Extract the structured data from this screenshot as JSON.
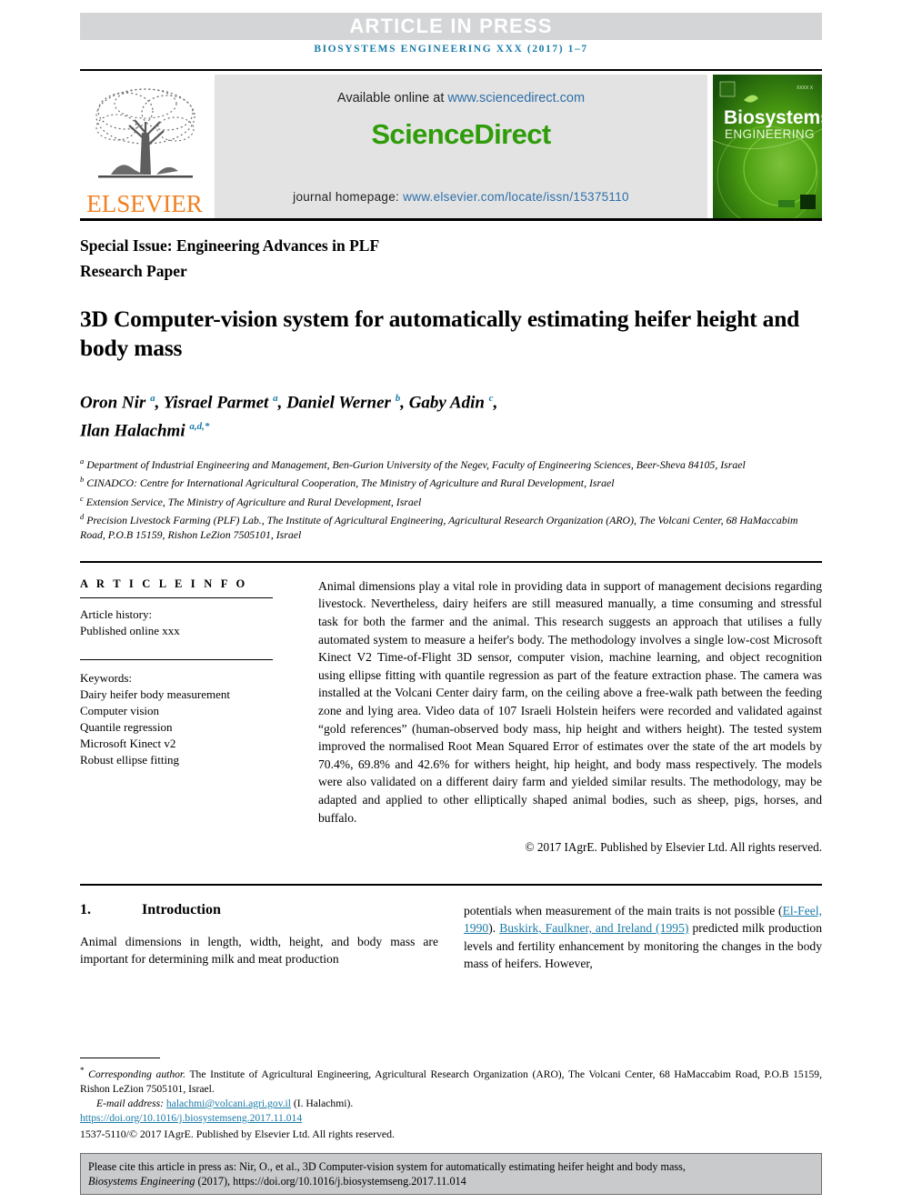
{
  "banner": {
    "text": "ARTICLE IN PRESS"
  },
  "journal_ref": "BIOSYSTEMS ENGINEERING XXX (2017) 1–7",
  "masthead": {
    "elsevier_wordmark": "ELSEVIER",
    "available_prefix": "Available online at ",
    "available_link": "www.sciencedirect.com",
    "sciencedirect_logo": "ScienceDirect",
    "homepage_prefix": "journal homepage: ",
    "homepage_link": "www.elsevier.com/locate/issn/15375110",
    "cover_title_line1": "Biosystems",
    "cover_title_line2": "ENGINEERING",
    "cover_issue": "XXXX X"
  },
  "header": {
    "special_issue": "Special Issue: Engineering Advances in PLF",
    "research_paper": "Research Paper"
  },
  "title": "3D Computer-vision system for automatically estimating heifer height and body mass",
  "authors_line1": "Oron Nir <sup>a</sup>, Yisrael Parmet <sup>a</sup>, Daniel Werner <sup>b</sup>, Gaby Adin <sup>c</sup>,",
  "authors_line2": "Ilan Halachmi <sup>a,d,*</sup>",
  "affiliations": [
    "<sup>a</sup> Department of Industrial Engineering and Management, Ben-Gurion University of the Negev, Faculty of Engineering Sciences, Beer-Sheva 84105, Israel",
    "<sup>b</sup> CINADCO: Centre for International Agricultural Cooperation, The Ministry of Agriculture and Rural Development, Israel",
    "<sup>c</sup> Extension Service, The Ministry of Agriculture and Rural Development, Israel",
    "<sup>d</sup> Precision Livestock Farming (PLF) Lab., The Institute of Agricultural Engineering, Agricultural Research Organization (ARO), The Volcani Center, 68 HaMaccabim Road, P.O.B 15159, Rishon LeZion 7505101, Israel"
  ],
  "article_info": {
    "heading": "A R T I C L E   I N F O",
    "history_label": "Article history:",
    "history_value": "Published online xxx",
    "keywords_label": "Keywords:",
    "keywords": [
      "Dairy heifer body measurement",
      "Computer vision",
      "Quantile regression",
      "Microsoft Kinect v2",
      "Robust ellipse fitting"
    ]
  },
  "abstract": "Animal dimensions play a vital role in providing data in support of management decisions regarding livestock. Nevertheless, dairy heifers are still measured manually, a time consuming and stressful task for both the farmer and the animal. This research suggests an approach that utilises a fully automated system to measure a heifer's body. The methodology involves a single low-cost Microsoft Kinect V2 Time-of-Flight 3D sensor, computer vision, machine learning, and object recognition using ellipse fitting with quantile regression as part of the feature extraction phase. The camera was installed at the Volcani Center dairy farm, on the ceiling above a free-walk path between the feeding zone and lying area. Video data of 107 Israeli Holstein heifers were recorded and validated against “gold references” (human-observed body mass, hip height and withers height). The tested system improved the normalised Root Mean Squared Error of estimates over the state of the art models by 70.4%, 69.8% and 42.6% for withers height, hip height, and body mass respectively. The models were also validated on a different dairy farm and yielded similar results. The methodology, may be adapted and applied to other elliptically shaped animal bodies, such as sheep, pigs, horses, and buffalo.",
  "copyright_abstract": "© 2017 IAgrE. Published by Elsevier Ltd. All rights reserved.",
  "section": {
    "number": "1.",
    "title": "Introduction"
  },
  "body_left": "Animal dimensions in length, width, height, and body mass are important for determining milk and meat production",
  "body_right_pre": "potentials when measurement of the main traits is not possible (",
  "body_right_ref1": "El-Feel, 1990",
  "body_right_mid": "). ",
  "body_right_ref2": "Buskirk, Faulkner, and Ireland (1995)",
  "body_right_post": " predicted milk production levels and fertility enhancement by monitoring the changes in the body mass of heifers. However,",
  "footnotes": {
    "corresponding_marker": "*",
    "corresponding": "Corresponding author.",
    "corresponding_rest": " The Institute of Agricultural Engineering, Agricultural Research Organization (ARO), The Volcani Center, 68 HaMaccabim Road, P.O.B 15159, Rishon LeZion 7505101, Israel.",
    "email_label": "E-mail address:",
    "email_link": "halachmi@volcani.agri.gov.il",
    "email_suffix": " (I. Halachmi).",
    "doi_link": "https://doi.org/10.1016/j.biosystemseng.2017.11.014",
    "issn_line": "1537-5110/© 2017 IAgrE. Published by Elsevier Ltd. All rights reserved."
  },
  "cite_box": {
    "line1_pre": "Please cite this article in press as: Nir, O., et al., 3D Computer-vision system for automatically estimating heifer height and body mass,",
    "line2_italic": "Biosystems Engineering",
    "line2_rest": " (2017), https://doi.org/10.1016/j.biosystemseng.2017.11.014"
  },
  "colors": {
    "banner_bg": "#d4d5d7",
    "link_blue": "#1a7ba8",
    "sciencedirect_green": "#2f9c0a",
    "elsevier_orange": "#f08020",
    "cite_box_bg": "#c9cacc"
  }
}
